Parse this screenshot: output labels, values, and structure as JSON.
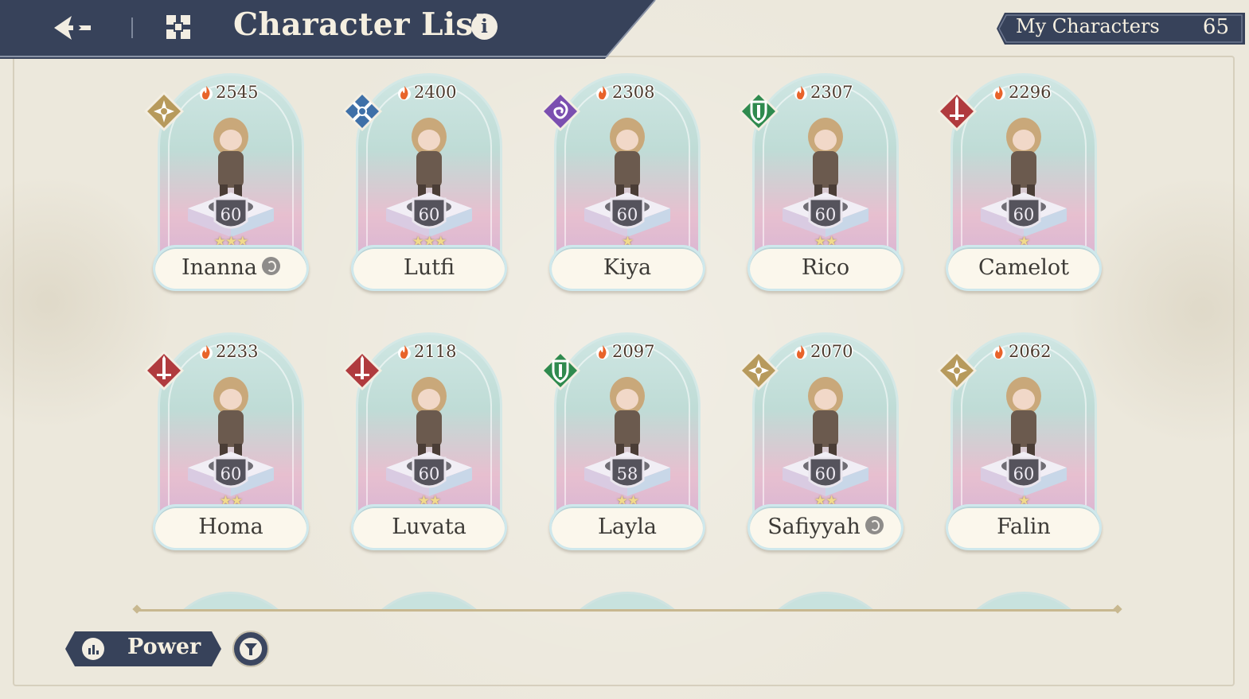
{
  "header": {
    "title": "Character List",
    "back_icon": "back-arrow-icon",
    "menu_icon": "grid-menu-icon",
    "info_label": "i"
  },
  "my_characters": {
    "label": "My Characters",
    "count": "65"
  },
  "class_colors": {
    "star": "#b79a5c",
    "sword": "#b03b3e",
    "shield": "#2f8a4e",
    "cross": "#3f70a8",
    "spiral": "#7b4fb0"
  },
  "characters": [
    {
      "name": "Inanna",
      "power": "2545",
      "level": "60",
      "stars": 3,
      "class": "star",
      "affinity": true
    },
    {
      "name": "Lutfi",
      "power": "2400",
      "level": "60",
      "stars": 3,
      "class": "cross",
      "affinity": false
    },
    {
      "name": "Kiya",
      "power": "2308",
      "level": "60",
      "stars": 1,
      "class": "spiral",
      "affinity": false
    },
    {
      "name": "Rico",
      "power": "2307",
      "level": "60",
      "stars": 2,
      "class": "shield",
      "affinity": false
    },
    {
      "name": "Camelot",
      "power": "2296",
      "level": "60",
      "stars": 1,
      "class": "sword",
      "affinity": false
    },
    {
      "name": "Homa",
      "power": "2233",
      "level": "60",
      "stars": 2,
      "class": "sword",
      "affinity": false
    },
    {
      "name": "Luvata",
      "power": "2118",
      "level": "60",
      "stars": 2,
      "class": "sword",
      "affinity": false
    },
    {
      "name": "Layla",
      "power": "2097",
      "level": "58",
      "stars": 2,
      "class": "shield",
      "affinity": false
    },
    {
      "name": "Safiyyah",
      "power": "2070",
      "level": "60",
      "stars": 2,
      "class": "star",
      "affinity": true
    },
    {
      "name": "Falin",
      "power": "2062",
      "level": "60",
      "stars": 1,
      "class": "star",
      "affinity": false
    }
  ],
  "sort": {
    "label": "Power",
    "icon": "bar-chart-icon"
  },
  "filter": {
    "icon": "filter-icon"
  }
}
